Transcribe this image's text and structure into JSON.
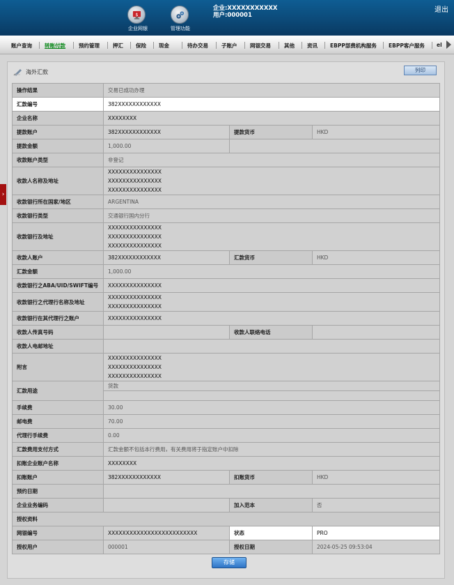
{
  "header": {
    "icon1_label": "企业网银",
    "icon2_label": "管理功能",
    "company_line": "企业:XXXXXXXXXXX",
    "user_line": "用户:000001",
    "logout": "退出"
  },
  "nav": {
    "items": [
      "账户查询",
      "转账付款",
      "预约管理",
      "押汇",
      "保险",
      "现金",
      "待办交易",
      "子账户",
      "网银交易",
      "其他",
      "资讯",
      "EBPP部费机构服务",
      "EBPP客户服务",
      "el"
    ],
    "active_index": 1
  },
  "side_tab": "›",
  "panel": {
    "title": "海外汇款",
    "print_label": "列印",
    "submit_label": "存储"
  },
  "form": {
    "op_result": {
      "label": "操作结果",
      "value": "交易已成功办理"
    },
    "remit_no": {
      "label": "汇款编号",
      "value": "382XXXXXXXXXXXX"
    },
    "company_name": {
      "label": "企业名称",
      "value": "XXXXXXXX"
    },
    "pay_account": {
      "label": "提款账户",
      "value": "382XXXXXXXXXXXX",
      "label2": "提款货币",
      "value2": "HKD"
    },
    "pay_amount": {
      "label": "提款金额",
      "value": "1,000.00"
    },
    "payee_acct_type": {
      "label": "收款账户类型",
      "value": "非登记"
    },
    "payee_name_addr": {
      "label": "收款人名称及地址",
      "lines": [
        "XXXXXXXXXXXXXXX",
        "XXXXXXXXXXXXXXX",
        "XXXXXXXXXXXXXXX"
      ]
    },
    "bank_country": {
      "label": "收款银行所在国家/地区",
      "value": "ARGENTINA"
    },
    "bank_type": {
      "label": "收款银行类型",
      "value": "交通银行国内分行"
    },
    "bank_addr": {
      "label": "收款银行及地址",
      "lines": [
        "XXXXXXXXXXXXXXX",
        "XXXXXXXXXXXXXXX",
        "XXXXXXXXXXXXXXX"
      ]
    },
    "payee_account": {
      "label": "收款人账户",
      "value": "382XXXXXXXXXXXX",
      "label2": "汇款货币",
      "value2": "HKD"
    },
    "remit_amount": {
      "label": "汇款金额",
      "value": "1,000.00"
    },
    "swift": {
      "label": "收款银行之ABA/UID/SWIFT编号",
      "value": "XXXXXXXXXXXXXXX"
    },
    "agent_bank": {
      "label": "收款银行之代理行名称及地址",
      "lines": [
        "XXXXXXXXXXXXXXX",
        "XXXXXXXXXXXXXXX"
      ]
    },
    "agent_account": {
      "label": "收款银行在其代理行之账户",
      "value": "XXXXXXXXXXXXXXX"
    },
    "payee_fax": {
      "label": "收款人传真号码",
      "value": "",
      "label2": "收款人联络电话",
      "value2": ""
    },
    "payee_email": {
      "label": "收款人电邮地址",
      "value": ""
    },
    "remark": {
      "label": "附言",
      "lines": [
        "XXXXXXXXXXXXXXX",
        "XXXXXXXXXXXXXXX",
        "XXXXXXXXXXXXXXX"
      ]
    },
    "purpose": {
      "label": "汇款用途",
      "value": "货款"
    },
    "fee": {
      "label": "手续费",
      "value": "30.00"
    },
    "postage": {
      "label": "邮电费",
      "value": "70.00"
    },
    "agent_fee": {
      "label": "代理行手续费",
      "value": "0.00"
    },
    "fee_method": {
      "label": "汇款费用支付方式",
      "value": "汇款金额不包括本行费用，有关费用将于指定账户中扣除"
    },
    "debit_name": {
      "label": "扣账企业账户名称",
      "value": "XXXXXXXX"
    },
    "debit_account": {
      "label": "扣账账户",
      "value": "382XXXXXXXXXXXX",
      "label2": "扣账货币",
      "value2": "HKD"
    },
    "booking_date": {
      "label": "预约日期",
      "value": ""
    },
    "biz_code": {
      "label": "企业业务编码",
      "value": "",
      "label2": "加入范本",
      "value2": "否"
    },
    "auth_section": {
      "label": "授权资料"
    },
    "netbank_no": {
      "label": "网银编号",
      "value": "XXXXXXXXXXXXXXXXXXXXXXXXX",
      "label2": "状态",
      "value2": "PRO"
    },
    "auth_user": {
      "label": "授权用户",
      "value": "000001",
      "label2": "授权日期",
      "value2": "2024-05-25 09:53:04"
    }
  }
}
